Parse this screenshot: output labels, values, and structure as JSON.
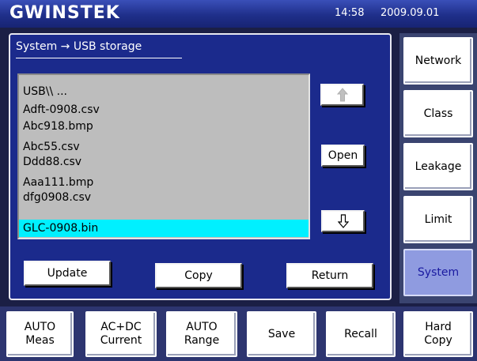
{
  "header": {
    "logo": "GWINSTEK",
    "time": "14:58",
    "date": "2009.09.01"
  },
  "breadcrumb": "System → USB storage",
  "file_list": [
    "USB\\\\ ...",
    "Adft-0908.csv",
    "Abc918.bmp",
    "Abc55.csv",
    "Ddd88.csv",
    "Aaa111.bmp",
    "dfg0908.csv",
    "GLC-0908.bin"
  ],
  "selected_file": "GLC-0908.bin",
  "list_buttons": {
    "up_icon": "arrow-up-icon",
    "open": "Open",
    "down_icon": "arrow-down-icon"
  },
  "action_buttons": {
    "update": "Update",
    "copy": "Copy",
    "return": "Return"
  },
  "side_menu": [
    {
      "label": "Network",
      "active": false
    },
    {
      "label": "Class",
      "active": false
    },
    {
      "label": "Leakage",
      "active": false
    },
    {
      "label": "Limit",
      "active": false
    },
    {
      "label": "System",
      "active": true
    }
  ],
  "bottom_menu": [
    {
      "line1": "AUTO",
      "line2": "Meas"
    },
    {
      "line1": "AC+DC",
      "line2": "Current"
    },
    {
      "line1": "AUTO",
      "line2": "Range"
    },
    {
      "line1": "Save",
      "line2": ""
    },
    {
      "line1": "Recall",
      "line2": ""
    },
    {
      "line1": "Hard",
      "line2": "Copy"
    }
  ],
  "colors": {
    "panel": "#1b2a8c",
    "list_bg": "#bdbdbd",
    "selection": "#00f0ff",
    "active_tab": "#8f9be0"
  }
}
